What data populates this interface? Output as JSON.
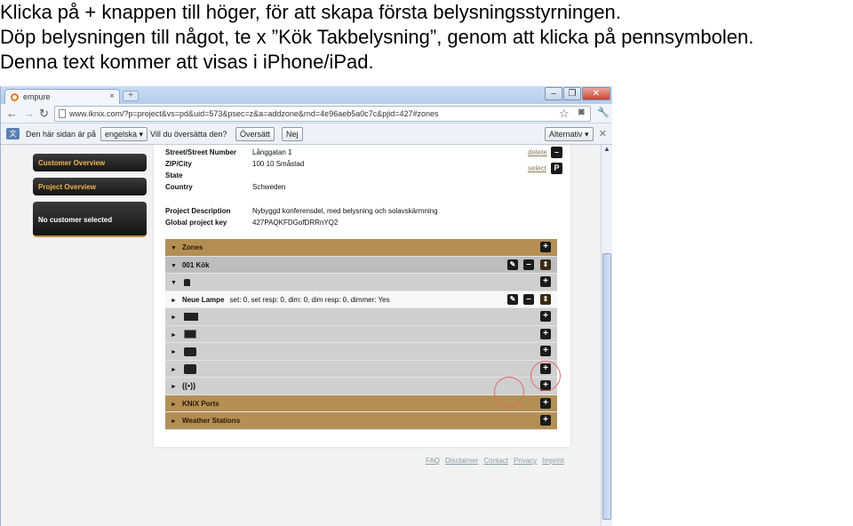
{
  "caption": {
    "line1": "Klicka på + knappen till höger, för att skapa första belysningsstyrningen.",
    "line2": "Döp belysningen till något, te x ”Kök Takbelysning”, genom att klicka på pennsymbolen.",
    "line3": "Denna text kommer att visas i iPhone/iPad."
  },
  "browser": {
    "tab_title": "empure",
    "url": "www.iknix.com/?p=project&vs=pd&uid=573&psec=z&a=addzone&rnd=4e96aeb5a0c7c&pjid=427#zones",
    "translate_prompt": "Den här sidan är på",
    "translate_lang": "engelska",
    "translate_question": "Vill du översätta den?",
    "translate_button": "Översätt",
    "no_button": "Nej",
    "options_button": "Alternativ"
  },
  "nav": {
    "customer_overview": "Customer Overview",
    "project_overview": "Project Overview",
    "no_customer": "No customer selected"
  },
  "project": {
    "street_label": "Street/Street Number",
    "street_value": "Långgatan 1",
    "zip_label": "ZIP/City",
    "zip_value": "100 10 Småstad",
    "state_label": "State",
    "state_value": "",
    "country_label": "Country",
    "country_value": "Schweden",
    "desc_label": "Project Description",
    "desc_value": "Nybyggd konferensdel, med belysning och solavskärmning",
    "key_label": "Global project key",
    "key_value": "427PAQKFDGofDRRnYQ2",
    "delete_link": "delete",
    "select_link": "select"
  },
  "zones": {
    "header": "Zones",
    "zone1": "001 Kök",
    "lamp_name": "Neue Lampe",
    "lamp_meta": "set: 0, set resp: 0, dim: 0, dim resp: 0, dimmer: Yes",
    "knix_ports": "KNiX Ports",
    "weather": "Weather Stations"
  },
  "footer": {
    "faq": "FAQ",
    "disclaimer": "Disclaimer",
    "contact": "Contact",
    "privacy": "Privacy",
    "imprint": "Imprint"
  }
}
